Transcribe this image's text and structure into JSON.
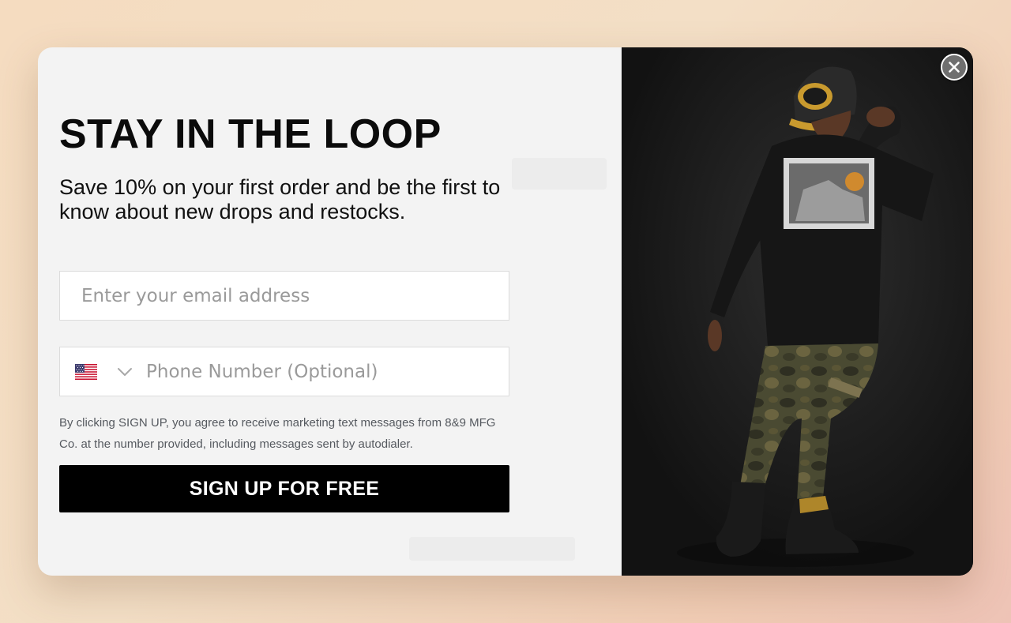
{
  "popup": {
    "headline": "STAY IN THE LOOP",
    "subtext": "Save 10% on your first order and be the first to know about new drops and restocks.",
    "email_placeholder": "Enter your email address",
    "phone": {
      "country_flag_icon": "us-flag-icon",
      "dropdown_icon": "chevron-down-icon",
      "placeholder": "Phone Number (Optional)"
    },
    "disclaimer": "By clicking SIGN UP, you agree to receive marketing text messages from 8&9 MFG Co. at the number provided, including messages sent by autodialer.",
    "submit_label": "SIGN UP FOR FREE",
    "close_icon": "close-icon"
  },
  "colors": {
    "form_background": "#f3f3f3",
    "button_background": "#000000",
    "button_text": "#ffffff",
    "page_background": "#f3dfc6"
  }
}
